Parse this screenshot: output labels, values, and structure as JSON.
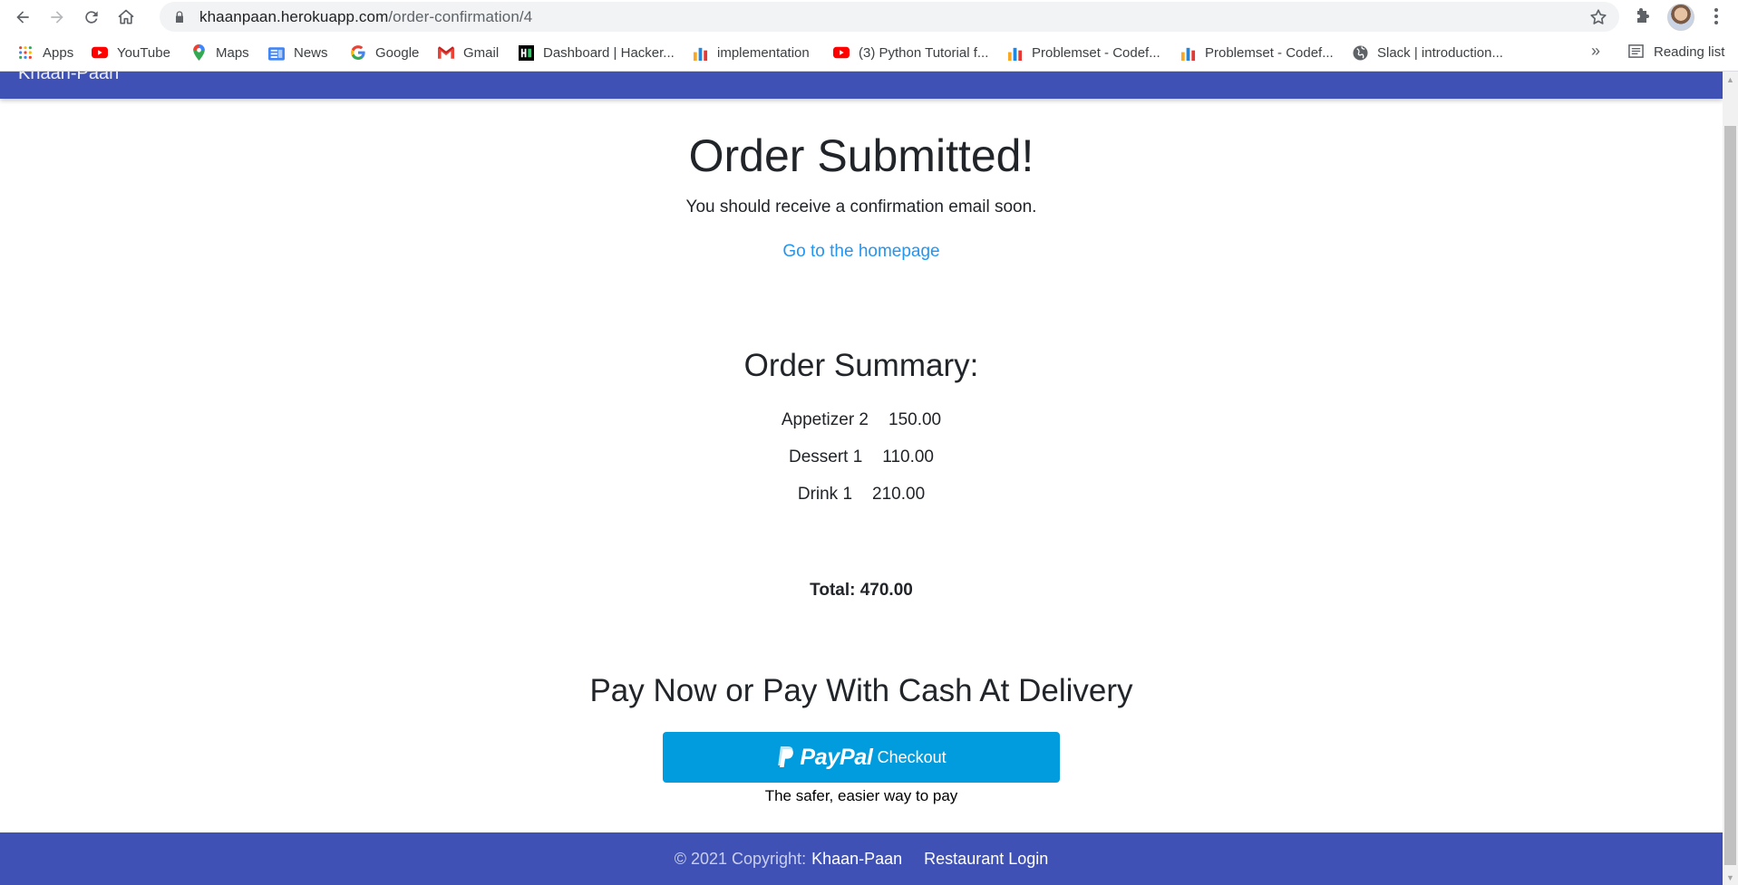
{
  "browser": {
    "url_host": "khaanpaan.herokuapp.com",
    "url_path": "/order-confirmation/4",
    "bookmarks": [
      {
        "label": "Apps",
        "icon": "apps-grid-icon"
      },
      {
        "label": "YouTube",
        "icon": "youtube-icon"
      },
      {
        "label": "Maps",
        "icon": "maps-pin-icon"
      },
      {
        "label": "News",
        "icon": "news-icon"
      },
      {
        "label": "Google",
        "icon": "google-icon"
      },
      {
        "label": "Gmail",
        "icon": "gmail-icon"
      },
      {
        "label": "Dashboard | Hacker...",
        "icon": "hackerrank-icon"
      },
      {
        "label": "implementation",
        "icon": "bar-chart-icon"
      },
      {
        "label": "(3) Python Tutorial f...",
        "icon": "youtube-icon"
      },
      {
        "label": "Problemset - Codef...",
        "icon": "bar-chart-icon"
      },
      {
        "label": "Problemset - Codef...",
        "icon": "bar-chart-icon"
      },
      {
        "label": "Slack | introduction...",
        "icon": "globe-icon"
      }
    ],
    "more": "»",
    "reading_list": "Reading list"
  },
  "navbar": {
    "brand": "Khaan-Paan"
  },
  "confirmation": {
    "title": "Order Submitted!",
    "subtitle": "You should receive a confirmation email soon.",
    "home_link": "Go to the homepage"
  },
  "summary": {
    "title": "Order Summary:",
    "items": [
      {
        "name": "Appetizer 2",
        "price": "150.00"
      },
      {
        "name": "Dessert 1",
        "price": "110.00"
      },
      {
        "name": "Drink 1",
        "price": "210.00"
      }
    ],
    "total": "Total: 470.00"
  },
  "payment": {
    "title": "Pay Now or Pay With Cash At Delivery",
    "paypal_word": "PayPal",
    "paypal_checkout": "Checkout",
    "tagline": "The safer, easier way to pay"
  },
  "footer": {
    "copyright": "© 2021 Copyright:",
    "brand_link": "Khaan-Paan",
    "login_link": "Restaurant Login"
  },
  "colors": {
    "primary": "#3f51b5",
    "link": "#2196f3",
    "paypal": "#009cde"
  }
}
